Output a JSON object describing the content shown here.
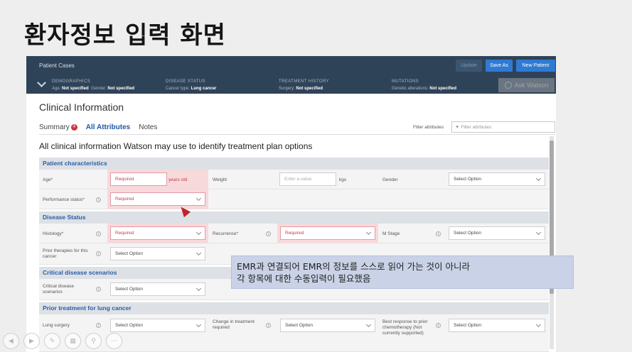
{
  "slide_title": "환자정보 입력 화면",
  "topbar": {
    "cases_label": "Patient Cases",
    "update_label": "Update",
    "saveas_label": "Save As",
    "newpatient_label": "New Patient",
    "ask_label": "Ask Watson",
    "summaries": [
      {
        "heading": "DEMOGRAPHICS",
        "k1": "Age:",
        "v1": "Not specified",
        "k2": "Gender:",
        "v2": "Not specified"
      },
      {
        "heading": "DISEASE STATUS",
        "k1": "Cancer type:",
        "v1": "Lung cancer"
      },
      {
        "heading": "TREATMENT HISTORY",
        "k1": "Surgery:",
        "v1": "Not specified"
      },
      {
        "heading": "MUTATIONS",
        "k1": "Genetic alterations:",
        "v1": "Not specified"
      }
    ]
  },
  "clinical_title": "Clinical Information",
  "tabs": {
    "summary": "Summary",
    "summary_badge": "4",
    "all": "All Attributes",
    "notes": "Notes"
  },
  "filter": {
    "label": "Filter attributes",
    "placeholder": "Filter attributes"
  },
  "intro": "All clinical information Watson may use to identify treatment plan options",
  "sections": {
    "patient": "Patient characteristics",
    "disease": "Disease Status",
    "critical": "Critical disease scenarios",
    "prior": "Prior treatment for lung cancer"
  },
  "fields": {
    "age_label": "Age*",
    "age_value": "Required",
    "age_unit": "years old",
    "weight_label": "Weight",
    "weight_placeholder": "Enter a value",
    "weight_unit": "kgs",
    "gender_label": "Gender",
    "gender_value": "Select Option",
    "perf_label": "Performance status*",
    "perf_value": "Required",
    "histology_label": "Histology*",
    "histology_value": "Required",
    "recurrence_label": "Recurrence*",
    "recurrence_value": "Required",
    "mstage_label": "M Stage",
    "mstage_value": "Select Option",
    "prior_therapies_label": "Prior therapies for this cancer",
    "prior_therapies_value": "Select Option",
    "critical_label": "Critical disease scenarios",
    "critical_value": "Select Option",
    "lung_surgery_label": "Lung surgery",
    "lung_surgery_value": "Select Option",
    "change_label": "Change in treatment required",
    "change_value": "Select Option",
    "best_label": "Best response to prior chemotherapy (Not currently supported)",
    "best_value": "Select Option"
  },
  "note_lines": [
    "EMR과 연결되어 EMR의 정보를 스스로 읽어 가는 것이 아니라",
    "각 항목에 대한 수동입력이 필요했음"
  ],
  "player_icons": [
    "prev-icon",
    "next-icon",
    "pen-icon",
    "slides-icon",
    "zoom-icon",
    "more-icon"
  ]
}
